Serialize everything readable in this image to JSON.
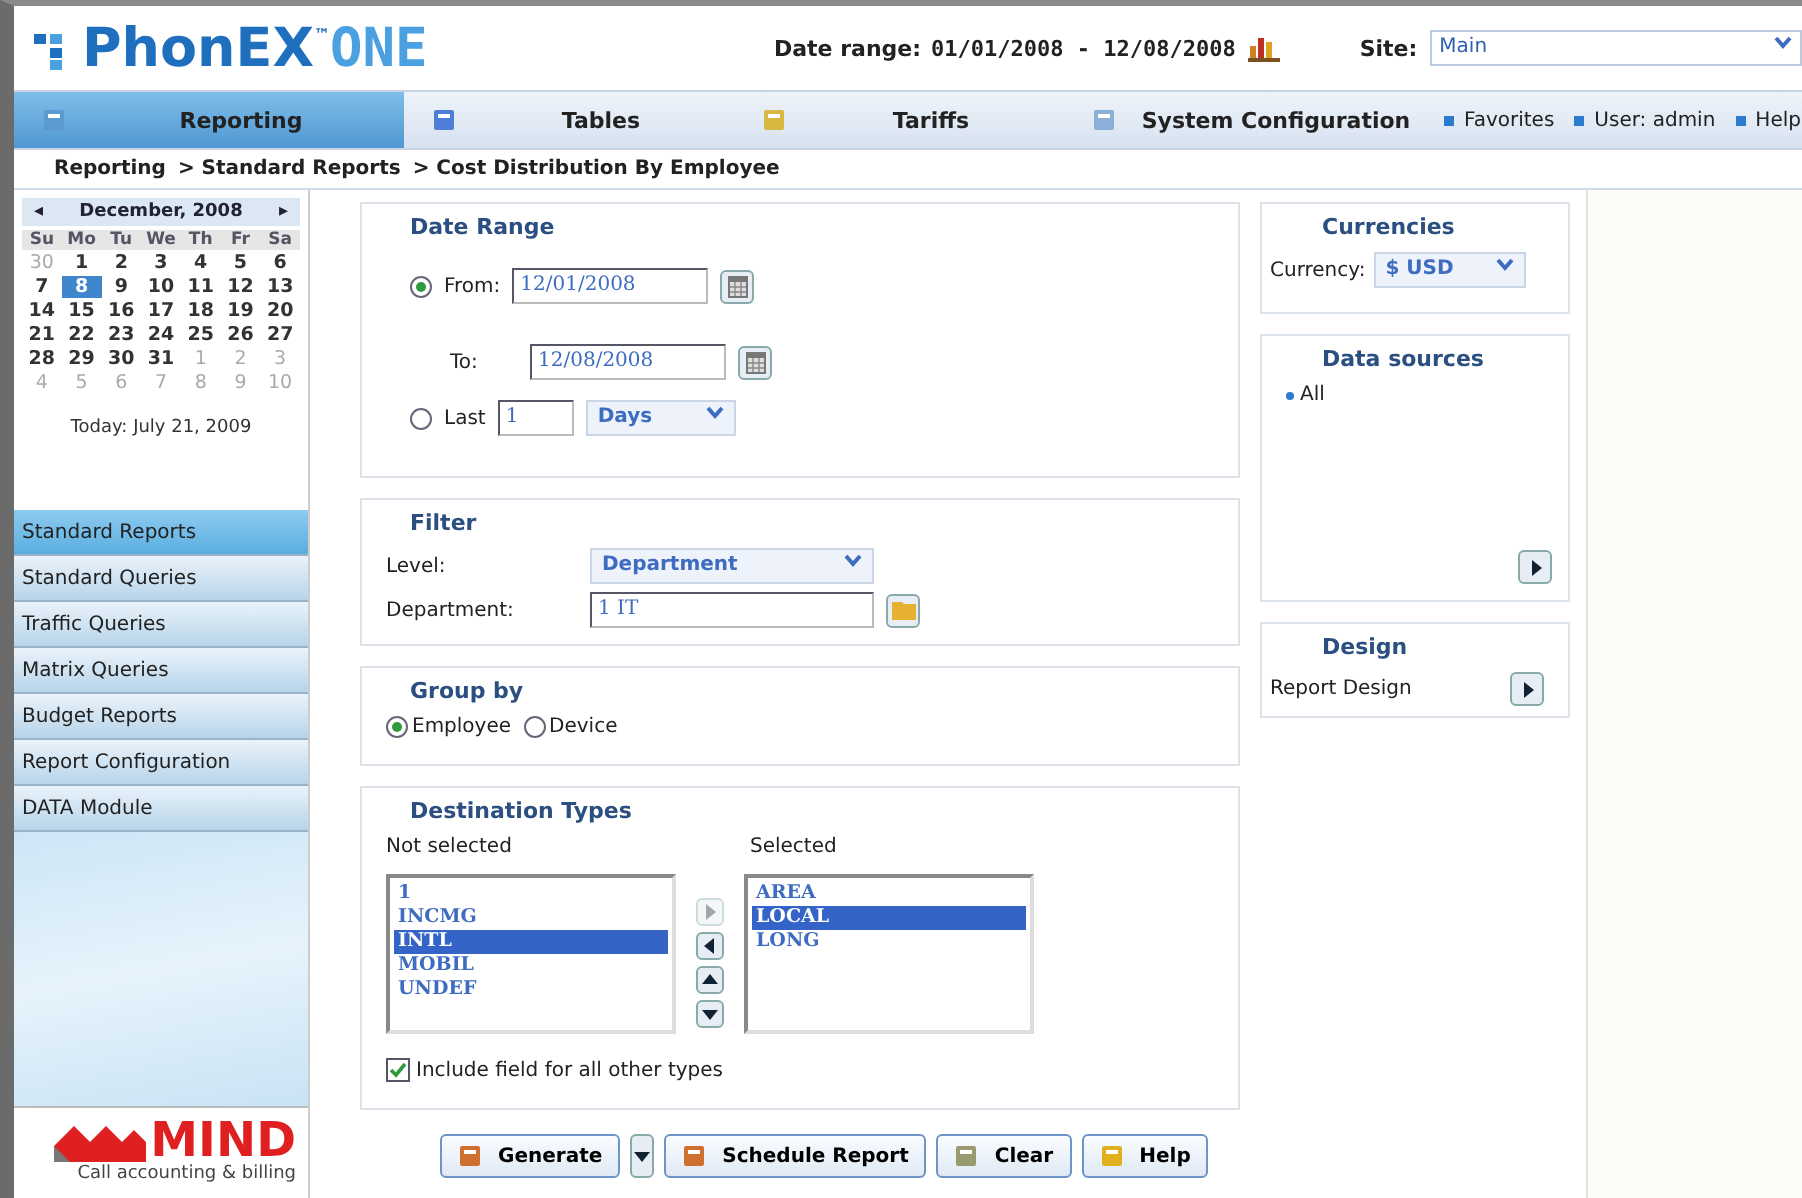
{
  "header": {
    "logo_main": "PhonEX",
    "logo_tm": "™",
    "logo_sub": "ONE",
    "date_range_label": "Date range:",
    "date_range": "01/01/2008 - 12/08/2008",
    "site_label": "Site:",
    "site_value": "Main"
  },
  "nav": [
    {
      "label": "Reporting",
      "selected": true
    },
    {
      "label": "Tables",
      "selected": false
    },
    {
      "label": "Tariffs",
      "selected": false
    },
    {
      "label": "System Configuration",
      "selected": false
    }
  ],
  "links": [
    "Favorites",
    "User: admin",
    "Help"
  ],
  "breadcrumb": [
    "Reporting",
    "> Standard Reports",
    "> Cost Distribution By Employee"
  ],
  "calendar": {
    "month": "December, 2008",
    "prev": "◂",
    "next": "▸",
    "weekdays": [
      "Su",
      "Mo",
      "Tu",
      "We",
      "Th",
      "Fr",
      "Sa"
    ],
    "days": [
      {
        "d": "30",
        "other": true,
        "selected": false
      },
      {
        "d": "1",
        "other": false,
        "selected": false
      },
      {
        "d": "2",
        "other": false,
        "selected": false
      },
      {
        "d": "3",
        "other": false,
        "selected": false
      },
      {
        "d": "4",
        "other": false,
        "selected": false
      },
      {
        "d": "5",
        "other": false,
        "selected": false
      },
      {
        "d": "6",
        "other": false,
        "selected": false
      },
      {
        "d": "7",
        "other": false,
        "selected": false
      },
      {
        "d": "8",
        "other": false,
        "selected": true
      },
      {
        "d": "9",
        "other": false,
        "selected": false
      },
      {
        "d": "10",
        "other": false,
        "selected": false
      },
      {
        "d": "11",
        "other": false,
        "selected": false
      },
      {
        "d": "12",
        "other": false,
        "selected": false
      },
      {
        "d": "13",
        "other": false,
        "selected": false
      },
      {
        "d": "14",
        "other": false,
        "selected": false
      },
      {
        "d": "15",
        "other": false,
        "selected": false
      },
      {
        "d": "16",
        "other": false,
        "selected": false
      },
      {
        "d": "17",
        "other": false,
        "selected": false
      },
      {
        "d": "18",
        "other": false,
        "selected": false
      },
      {
        "d": "19",
        "other": false,
        "selected": false
      },
      {
        "d": "20",
        "other": false,
        "selected": false
      },
      {
        "d": "21",
        "other": false,
        "selected": false
      },
      {
        "d": "22",
        "other": false,
        "selected": false
      },
      {
        "d": "23",
        "other": false,
        "selected": false
      },
      {
        "d": "24",
        "other": false,
        "selected": false
      },
      {
        "d": "25",
        "other": false,
        "selected": false
      },
      {
        "d": "26",
        "other": false,
        "selected": false
      },
      {
        "d": "27",
        "other": false,
        "selected": false
      },
      {
        "d": "28",
        "other": false,
        "selected": false
      },
      {
        "d": "29",
        "other": false,
        "selected": false
      },
      {
        "d": "30",
        "other": false,
        "selected": false
      },
      {
        "d": "31",
        "other": false,
        "selected": false
      },
      {
        "d": "1",
        "other": true,
        "selected": false
      },
      {
        "d": "2",
        "other": true,
        "selected": false
      },
      {
        "d": "3",
        "other": true,
        "selected": false
      },
      {
        "d": "4",
        "other": true,
        "selected": false
      },
      {
        "d": "5",
        "other": true,
        "selected": false
      },
      {
        "d": "6",
        "other": true,
        "selected": false
      },
      {
        "d": "7",
        "other": true,
        "selected": false
      },
      {
        "d": "8",
        "other": true,
        "selected": false
      },
      {
        "d": "9",
        "other": true,
        "selected": false
      },
      {
        "d": "10",
        "other": true,
        "selected": false
      }
    ],
    "today": "Today: July 21, 2009"
  },
  "menu": [
    {
      "label": "Standard Reports",
      "selected": true
    },
    {
      "label": "Standard Queries",
      "selected": false
    },
    {
      "label": "Traffic Queries",
      "selected": false
    },
    {
      "label": "Matrix Queries",
      "selected": false
    },
    {
      "label": "Budget Reports",
      "selected": false
    },
    {
      "label": "Report Configuration",
      "selected": false
    },
    {
      "label": "DATA Module",
      "selected": false
    }
  ],
  "brand": {
    "name": "MIND",
    "tagline": "Call accounting & billing"
  },
  "date_range": {
    "title": "Date Range",
    "from_label": "From:",
    "from_selected": true,
    "from": "12/01/2008",
    "to_label": "To:",
    "to": "12/08/2008",
    "last_label": "Last",
    "last_selected": false,
    "last_count": "1",
    "last_unit": "Days"
  },
  "filter": {
    "title": "Filter",
    "level_label": "Level:",
    "level": "Department",
    "department_label": "Department:",
    "department": "1 IT"
  },
  "group_by": {
    "title": "Group by",
    "options": [
      {
        "label": "Employee",
        "selected": true
      },
      {
        "label": "Device",
        "selected": false
      }
    ]
  },
  "destination_types": {
    "title": "Destination Types",
    "not_selected_label": "Not selected",
    "selected_label": "Selected",
    "not_selected": [
      {
        "label": "1",
        "selected": false
      },
      {
        "label": "INCMG",
        "selected": false
      },
      {
        "label": "INTL",
        "selected": true
      },
      {
        "label": "MOBIL",
        "selected": false
      },
      {
        "label": "UNDEF",
        "selected": false
      }
    ],
    "selected": [
      {
        "label": "AREA",
        "selected": false
      },
      {
        "label": "LOCAL",
        "selected": true
      },
      {
        "label": "LONG",
        "selected": false
      }
    ],
    "include_label": "Include field for all other types",
    "include_checked": true
  },
  "buttons": [
    "Generate",
    "Schedule Report",
    "Clear",
    "Help"
  ],
  "currencies": {
    "title": "Currencies",
    "label": "Currency:",
    "value": "$ USD"
  },
  "data_sources": {
    "title": "Data sources",
    "items": [
      "All"
    ]
  },
  "design": {
    "title": "Design",
    "label": "Report Design"
  }
}
